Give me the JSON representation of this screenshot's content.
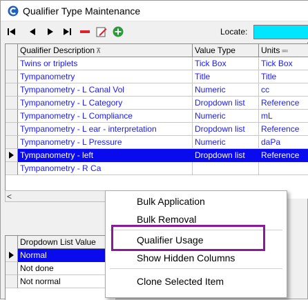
{
  "window": {
    "title": "Qualifier Type Maintenance"
  },
  "toolbar": {
    "locate_label": "Locate:",
    "locate_value": "",
    "icons": [
      "first-record-icon",
      "previous-record-icon",
      "next-record-icon",
      "last-record-icon",
      "delete-record-icon",
      "edit-record-icon",
      "add-record-icon"
    ]
  },
  "main_grid": {
    "columns": [
      "Qualifier Description",
      "Value Type",
      "Units"
    ],
    "rows": [
      [
        "Twins or triplets",
        "Tick Box",
        "Tick Box"
      ],
      [
        "Tympanometry",
        "Title",
        "Title"
      ],
      [
        "Tympanometry - L Canal Vol",
        "Numeric",
        "cc"
      ],
      [
        "Tympanometry - L Category",
        "Dropdown list",
        "Reference"
      ],
      [
        "Tympanometry - L Compliance",
        "Numeric",
        "mL"
      ],
      [
        "Tympanometry - L ear - interpretation",
        "Dropdown list",
        "Reference"
      ],
      [
        "Tympanometry - L Pressure",
        "Numeric",
        "daPa"
      ],
      [
        "Tympanometry - left",
        "Dropdown list",
        "Reference"
      ],
      [
        "Tympanometry - R Ca",
        "",
        ""
      ]
    ],
    "selected_row": 7
  },
  "dropdown_grid": {
    "columns": [
      "Dropdown List Value"
    ],
    "rows": [
      [
        "Normal"
      ],
      [
        "Not done"
      ],
      [
        "Not normal"
      ]
    ],
    "selected_row": 0
  },
  "context_menu": {
    "items": [
      "Bulk Application",
      "Bulk Removal",
      "Qualifier Usage",
      "Show Hidden Columns",
      "Clone Selected Item"
    ],
    "highlighted": "Qualifier Usage"
  },
  "colors": {
    "selection": "#0a0aee",
    "link_text": "#1a1aff",
    "locate_bg": "#00e6ff",
    "highlight_border": "#8a1a9a",
    "delete_red": "#e0202a",
    "add_green": "#2a9a3a"
  }
}
